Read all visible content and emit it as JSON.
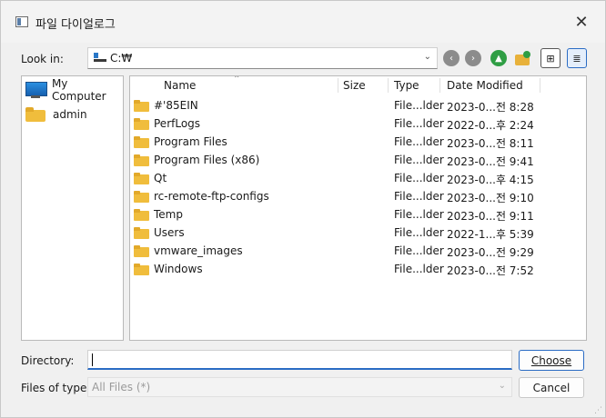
{
  "window": {
    "title": "파일 다이얼로그",
    "close_glyph": "✕"
  },
  "toolbar": {
    "look_in_label": "Look in:",
    "look_in_value": "C:₩",
    "back_glyph": "‹",
    "forward_glyph": "›",
    "up_glyph": "▲",
    "list_view_glyph": "⊞",
    "detail_view_glyph": "≣"
  },
  "sidebar": {
    "items": [
      {
        "label": "My Computer",
        "icon": "computer-icon"
      },
      {
        "label": "admin",
        "icon": "folder-icon"
      }
    ]
  },
  "filelist": {
    "columns": [
      "Name",
      "Size",
      "Type",
      "Date Modified"
    ],
    "rows": [
      {
        "name": "#'85EIN",
        "type": "File...lder",
        "date": "2023-0...전 8:28"
      },
      {
        "name": "PerfLogs",
        "type": "File...lder",
        "date": "2022-0...후 2:24"
      },
      {
        "name": "Program Files",
        "type": "File...lder",
        "date": "2023-0...전 8:11"
      },
      {
        "name": "Program Files (x86)",
        "type": "File...lder",
        "date": "2023-0...전 9:41"
      },
      {
        "name": "Qt",
        "type": "File...lder",
        "date": "2023-0...후 4:15"
      },
      {
        "name": "rc-remote-ftp-configs",
        "type": "File...lder",
        "date": "2023-0...전 9:10"
      },
      {
        "name": "Temp",
        "type": "File...lder",
        "date": "2023-0...전 9:11"
      },
      {
        "name": "Users",
        "type": "File...lder",
        "date": "2022-1...후 5:39"
      },
      {
        "name": "vmware_images",
        "type": "File...lder",
        "date": "2023-0...전 9:29"
      },
      {
        "name": "Windows",
        "type": "File...lder",
        "date": "2023-0...전 7:52"
      }
    ]
  },
  "footer": {
    "directory_label": "Directory:",
    "directory_value": "",
    "files_of_type_label": "Files of type:",
    "files_of_type_value": "All Files (*)",
    "choose_label": "Choose",
    "cancel_label": "Cancel"
  },
  "colors": {
    "accent": "#2b6cc4",
    "folder": "#f0bd3c",
    "up_green": "#2f9e44"
  }
}
